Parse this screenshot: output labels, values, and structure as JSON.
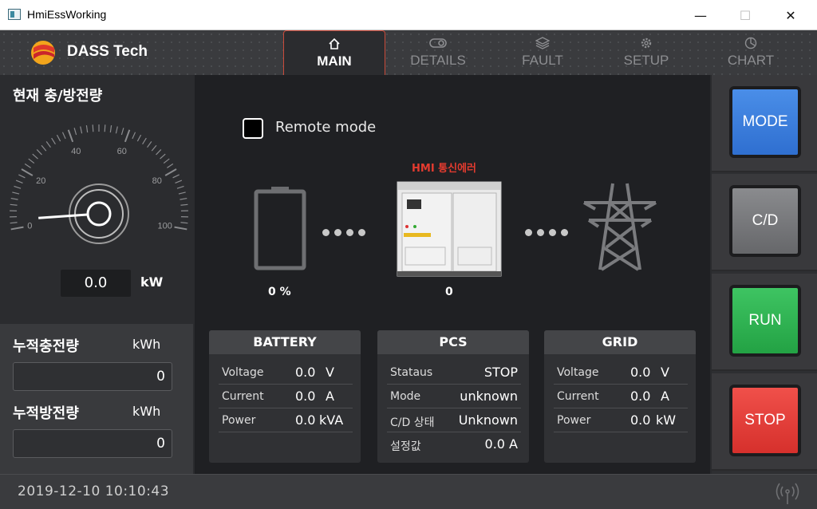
{
  "window": {
    "title": "HmiEssWorking",
    "minimize_glyph": "—",
    "maximize_glyph": "☐",
    "close_glyph": "✕"
  },
  "header": {
    "brand": "DASS Tech",
    "tabs": [
      {
        "label": "MAIN",
        "icon": "home-icon",
        "active": true
      },
      {
        "label": "DETAILS",
        "icon": "toggle-icon",
        "active": false
      },
      {
        "label": "FAULT",
        "icon": "layers-icon",
        "active": false
      },
      {
        "label": "SETUP",
        "icon": "gear-icon",
        "active": false
      },
      {
        "label": "CHART",
        "icon": "pie-icon",
        "active": false
      }
    ]
  },
  "left": {
    "title": "현재 충/방전량",
    "gauge": {
      "ticks": [
        "0",
        "20",
        "40",
        "60",
        "80",
        "100"
      ],
      "value": "0.0",
      "unit": "kW"
    },
    "charge": {
      "label": "누적충전량",
      "unit": "kWh",
      "value": "0"
    },
    "discharge": {
      "label": "누적방전량",
      "unit": "kWh",
      "value": "0"
    }
  },
  "center": {
    "remote_mode_label": "Remote mode",
    "remote_mode_checked": false,
    "hmi_error": "HMI 통신에러",
    "battery_percent": "0 %",
    "pcs_value": "0",
    "battery_card": {
      "title": "BATTERY",
      "rows": [
        {
          "label": "Voltage",
          "value": "0.0",
          "unit": "V"
        },
        {
          "label": "Current",
          "value": "0.0",
          "unit": "A"
        },
        {
          "label": "Power",
          "value": "0.0",
          "unit": "kVA"
        }
      ]
    },
    "pcs_card": {
      "title": "PCS",
      "rows": [
        {
          "label": "Stataus",
          "value": "STOP"
        },
        {
          "label": "Mode",
          "value": "unknown"
        },
        {
          "label": "C/D 상태",
          "value": "Unknown"
        },
        {
          "label": "설정값",
          "value": "0.0 A"
        }
      ]
    },
    "grid_card": {
      "title": "GRID",
      "rows": [
        {
          "label": "Voltage",
          "value": "0.0",
          "unit": "V"
        },
        {
          "label": "Current",
          "value": "0.0",
          "unit": "A"
        },
        {
          "label": "Power",
          "value": "0.0",
          "unit": "kW"
        }
      ]
    }
  },
  "controls": {
    "mode": "MODE",
    "cd": "C/D",
    "run": "RUN",
    "stop": "STOP"
  },
  "status": {
    "datetime": "2019-12-10   10:10:43"
  },
  "colors": {
    "accent_red": "#e43b2f",
    "mode_blue": "#3b7fe0",
    "run_green": "#2fb352",
    "stop_red": "#e2403b"
  }
}
